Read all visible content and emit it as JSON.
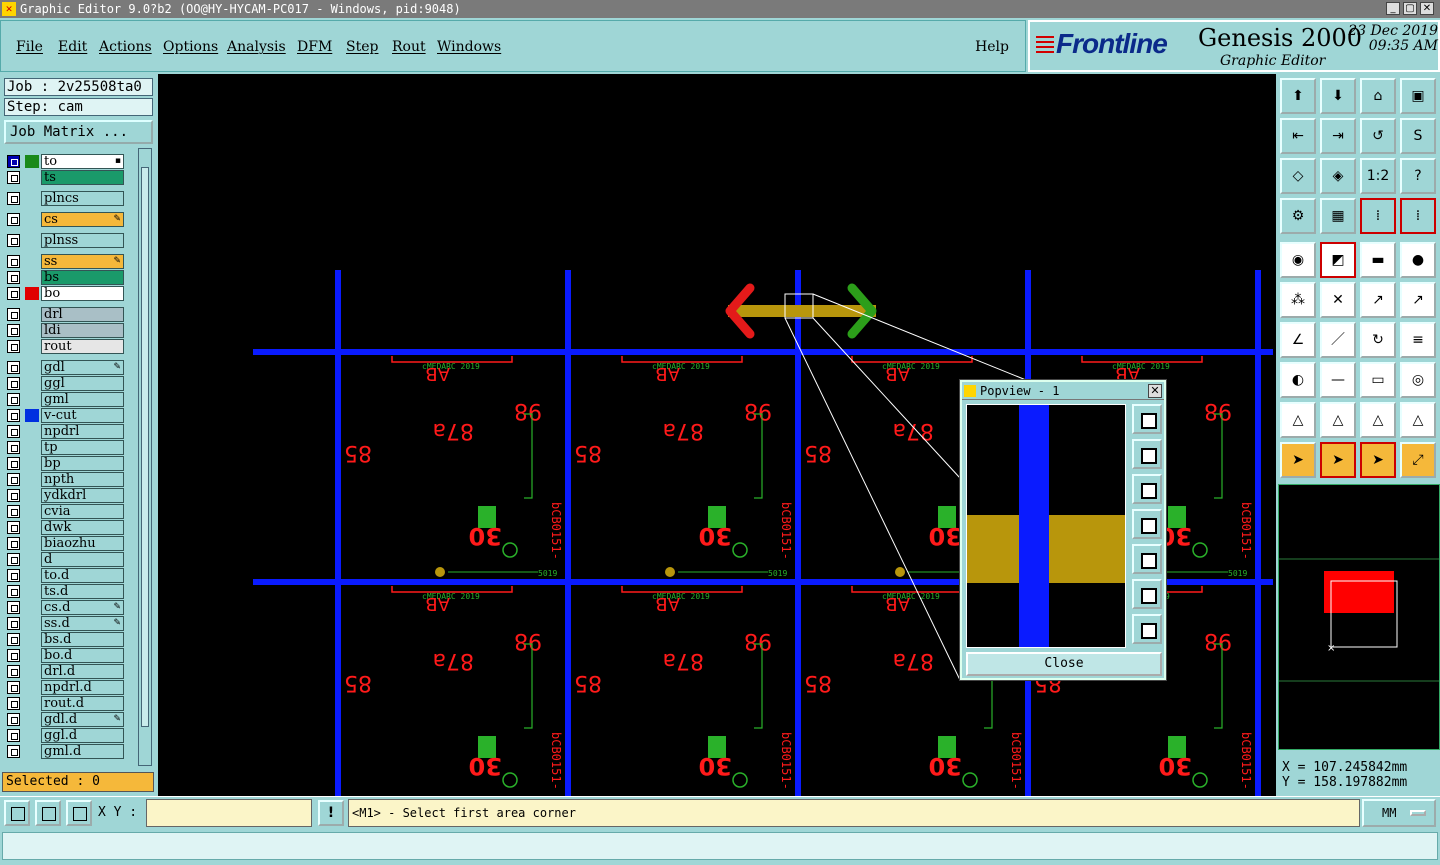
{
  "window": {
    "title": "Graphic Editor 9.0?b2 (OO@HY-HYCAM-PC017 - Windows, pid:9048)",
    "min_label": "_",
    "max_label": "▢",
    "close_label": "✕"
  },
  "menu": {
    "items": [
      "File",
      "Edit",
      "Actions",
      "Options",
      "Analysis",
      "DFM",
      "Step",
      "Rout",
      "Windows"
    ],
    "help": "Help"
  },
  "brand": {
    "logo": "Frontline",
    "product": "Genesis 2000",
    "subtitle": "Graphic Editor",
    "date": "23 Dec 2019",
    "time": "09:35 AM"
  },
  "job": {
    "job_label": "Job : 2v25508ta0",
    "step_label": "Step: cam",
    "matrix_button": "Job Matrix ..."
  },
  "layers": [
    {
      "name": "to",
      "color": "#ffffff",
      "swatch": "#1a8a1a",
      "checked": true,
      "mark": "▪"
    },
    {
      "name": "ts",
      "color": "#1a9a6a",
      "swatch": "",
      "checked": false,
      "mark": ""
    },
    {
      "name": "plncs",
      "color": "#9fd6d6",
      "swatch": "",
      "checked": false,
      "mark": "",
      "gap": true
    },
    {
      "name": "cs",
      "color": "#f5b83a",
      "swatch": "",
      "checked": false,
      "mark": "✎",
      "gap": true
    },
    {
      "name": "plnss",
      "color": "#9fd6d6",
      "swatch": "",
      "checked": false,
      "mark": "",
      "gap": true
    },
    {
      "name": "ss",
      "color": "#f5b83a",
      "swatch": "",
      "checked": false,
      "mark": "✎",
      "gap": true
    },
    {
      "name": "bs",
      "color": "#1a9a6a",
      "swatch": "",
      "checked": false,
      "mark": ""
    },
    {
      "name": "bo",
      "color": "#ffffff",
      "swatch": "#e00000",
      "checked": false,
      "mark": ""
    },
    {
      "name": "drl",
      "color": "#a9bfc6",
      "swatch": "",
      "checked": false,
      "mark": "",
      "gap": true
    },
    {
      "name": "ldi",
      "color": "#a9bfc6",
      "swatch": "",
      "checked": false,
      "mark": ""
    },
    {
      "name": "rout",
      "color": "#e6e6e6",
      "swatch": "",
      "checked": false,
      "mark": ""
    },
    {
      "name": "gdl",
      "color": "#9fd6d6",
      "swatch": "",
      "checked": false,
      "mark": "✎",
      "gap": true
    },
    {
      "name": "ggl",
      "color": "#9fd6d6",
      "swatch": "",
      "checked": false,
      "mark": ""
    },
    {
      "name": "gml",
      "color": "#9fd6d6",
      "swatch": "",
      "checked": false,
      "mark": ""
    },
    {
      "name": "v-cut",
      "color": "#9fd6d6",
      "swatch": "#0030e0",
      "checked": false,
      "mark": ""
    },
    {
      "name": "npdrl",
      "color": "#9fd6d6",
      "swatch": "",
      "checked": false,
      "mark": ""
    },
    {
      "name": "tp",
      "color": "#9fd6d6",
      "swatch": "",
      "checked": false,
      "mark": ""
    },
    {
      "name": "bp",
      "color": "#9fd6d6",
      "swatch": "",
      "checked": false,
      "mark": ""
    },
    {
      "name": "npth",
      "color": "#9fd6d6",
      "swatch": "",
      "checked": false,
      "mark": ""
    },
    {
      "name": "ydkdrl",
      "color": "#9fd6d6",
      "swatch": "",
      "checked": false,
      "mark": ""
    },
    {
      "name": "cvia",
      "color": "#9fd6d6",
      "swatch": "",
      "checked": false,
      "mark": ""
    },
    {
      "name": "dwk",
      "color": "#9fd6d6",
      "swatch": "",
      "checked": false,
      "mark": ""
    },
    {
      "name": "biaozhu",
      "color": "#9fd6d6",
      "swatch": "",
      "checked": false,
      "mark": ""
    },
    {
      "name": "d",
      "color": "#9fd6d6",
      "swatch": "",
      "checked": false,
      "mark": ""
    },
    {
      "name": "to.d",
      "color": "#9fd6d6",
      "swatch": "",
      "checked": false,
      "mark": ""
    },
    {
      "name": "ts.d",
      "color": "#9fd6d6",
      "swatch": "",
      "checked": false,
      "mark": ""
    },
    {
      "name": "cs.d",
      "color": "#9fd6d6",
      "swatch": "",
      "checked": false,
      "mark": "✎"
    },
    {
      "name": "ss.d",
      "color": "#9fd6d6",
      "swatch": "",
      "checked": false,
      "mark": "✎"
    },
    {
      "name": "bs.d",
      "color": "#9fd6d6",
      "swatch": "",
      "checked": false,
      "mark": ""
    },
    {
      "name": "bo.d",
      "color": "#9fd6d6",
      "swatch": "",
      "checked": false,
      "mark": ""
    },
    {
      "name": "drl.d",
      "color": "#9fd6d6",
      "swatch": "",
      "checked": false,
      "mark": ""
    },
    {
      "name": "npdrl.d",
      "color": "#9fd6d6",
      "swatch": "",
      "checked": false,
      "mark": ""
    },
    {
      "name": "rout.d",
      "color": "#9fd6d6",
      "swatch": "",
      "checked": false,
      "mark": ""
    },
    {
      "name": "gdl.d",
      "color": "#9fd6d6",
      "swatch": "",
      "checked": false,
      "mark": "✎"
    },
    {
      "name": "ggl.d",
      "color": "#9fd6d6",
      "swatch": "",
      "checked": false,
      "mark": ""
    },
    {
      "name": "gml.d",
      "color": "#9fd6d6",
      "swatch": "",
      "checked": false,
      "mark": ""
    }
  ],
  "selected": "Selected : 0",
  "canvas": {
    "board_texts": {
      "cell_label_a": "87a",
      "cell_label_b": "85",
      "cell_label_c": "98",
      "cell_label_d": "30",
      "cell_label_e": "AB",
      "part_code": "bCB0151-",
      "maker_label": "cMEDARC 2019",
      "small_label": "5019"
    }
  },
  "popview": {
    "title": "Popview - 1",
    "close_label": "Close"
  },
  "coords": {
    "x": "X  = 107.245842mm",
    "y": "Y  = 158.197882mm"
  },
  "bottom": {
    "xy_label": "X Y :",
    "xy_value": "",
    "prompt": "<M1> - Select first area corner",
    "units": "MM",
    "warn": "!"
  },
  "colors": {
    "bg": "#9fd6d6",
    "canvas": "#000000",
    "vcut": "#0a1bff",
    "text_red": "#ff1a1a",
    "pad_gold": "#b8960c",
    "silk_green": "#2ab12a"
  }
}
